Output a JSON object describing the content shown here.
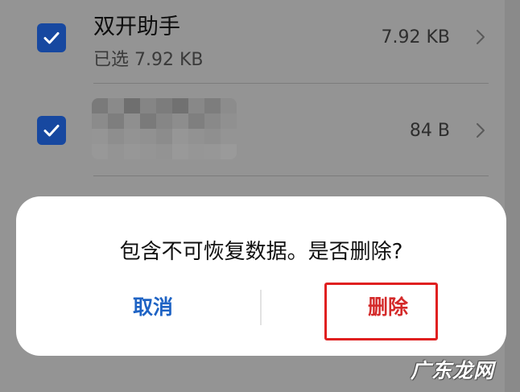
{
  "list": {
    "items": [
      {
        "title": "双开助手",
        "subtitle": "已选 7.92 KB",
        "size": "7.92 KB",
        "checked": true
      },
      {
        "title": "",
        "subtitle": "",
        "size": "84 B",
        "checked": true
      }
    ]
  },
  "dialog": {
    "message": "包含不可恢复数据。是否删除?",
    "cancel_label": "取消",
    "delete_label": "删除"
  },
  "watermark": "广东龙网",
  "colors": {
    "accent": "#1e63c4",
    "danger": "#d42a2a",
    "checkbox": "#1748a0",
    "highlight": "#e02020"
  }
}
